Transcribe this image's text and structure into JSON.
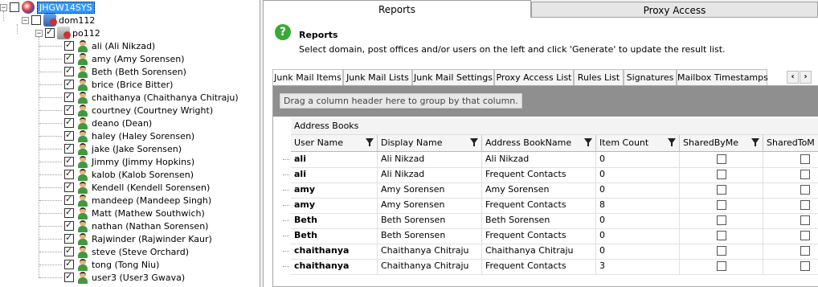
{
  "tree": {
    "system": {
      "label": "JHGW14SYS",
      "checked": false
    },
    "domain": {
      "label": "dom112",
      "checked": false
    },
    "post_office": {
      "label": "po112",
      "checked": true
    },
    "users": [
      {
        "label": "ali (Ali Nikzad)",
        "checked": true
      },
      {
        "label": "amy (Amy Sorensen)",
        "checked": true
      },
      {
        "label": "Beth (Beth Sorensen)",
        "checked": true
      },
      {
        "label": "brice (Brice Bitter)",
        "checked": true
      },
      {
        "label": "chaithanya (Chaithanya Chitraju)",
        "checked": true
      },
      {
        "label": "courtney (Courtney Wright)",
        "checked": true
      },
      {
        "label": "deano (Dean)",
        "checked": true
      },
      {
        "label": "haley (Haley Sorensen)",
        "checked": true
      },
      {
        "label": "jake (Jake Sorensen)",
        "checked": true
      },
      {
        "label": "Jimmy (Jimmy Hopkins)",
        "checked": true
      },
      {
        "label": "kalob (Kalob Sorensen)",
        "checked": true
      },
      {
        "label": "Kendell (Kendell Sorensen)",
        "checked": true
      },
      {
        "label": "mandeep (Mandeep Singh)",
        "checked": true
      },
      {
        "label": "Matt (Mathew Southwich)",
        "checked": true
      },
      {
        "label": "nathan (Nathan Sorensen)",
        "checked": true
      },
      {
        "label": "Rajwinder (Rajwinder Kaur)",
        "checked": true
      },
      {
        "label": "steve (Steve Orchard)",
        "checked": true
      },
      {
        "label": "tong (Tong Niu)",
        "checked": true
      },
      {
        "label": "user3 (User3 Gwava)",
        "checked": true
      }
    ]
  },
  "top_tabs": {
    "reports": "Reports",
    "proxy_access": "Proxy Access"
  },
  "header": {
    "title": "Reports",
    "description": "Select domain, post offices and/or users on the left and click 'Generate' to update the result list."
  },
  "sub_tabs": [
    "Junk Mail Items",
    "Junk Mail Lists",
    "Junk Mail Settings",
    "Proxy Access List",
    "Rules List",
    "Signatures",
    "Mailbox Timestamps"
  ],
  "grid": {
    "group_hint": "Drag a column header here to group by that column.",
    "band": "Address Books",
    "columns": [
      "User Name",
      "Display Name",
      "Address BookName",
      "Item Count",
      "SharedByMe",
      "SharedToM"
    ],
    "rows": [
      {
        "user": "ali",
        "display": "Ali Nikzad",
        "book": "Ali Nikzad",
        "count": "0"
      },
      {
        "user": "ali",
        "display": "Ali Nikzad",
        "book": "Frequent Contacts",
        "count": "0"
      },
      {
        "user": "amy",
        "display": "Amy Sorensen",
        "book": "Amy Sorensen",
        "count": "0"
      },
      {
        "user": "amy",
        "display": "Amy Sorensen",
        "book": "Frequent Contacts",
        "count": "8"
      },
      {
        "user": "Beth",
        "display": "Beth Sorensen",
        "book": "Beth Sorensen",
        "count": "0"
      },
      {
        "user": "Beth",
        "display": "Beth Sorensen",
        "book": "Frequent Contacts",
        "count": "0"
      },
      {
        "user": "chaithanya",
        "display": "Chaithanya Chitraju",
        "book": "Chaithanya Chitraju",
        "count": "0"
      },
      {
        "user": "chaithanya",
        "display": "Chaithanya Chitraju",
        "book": "Frequent Contacts",
        "count": "3"
      }
    ]
  }
}
